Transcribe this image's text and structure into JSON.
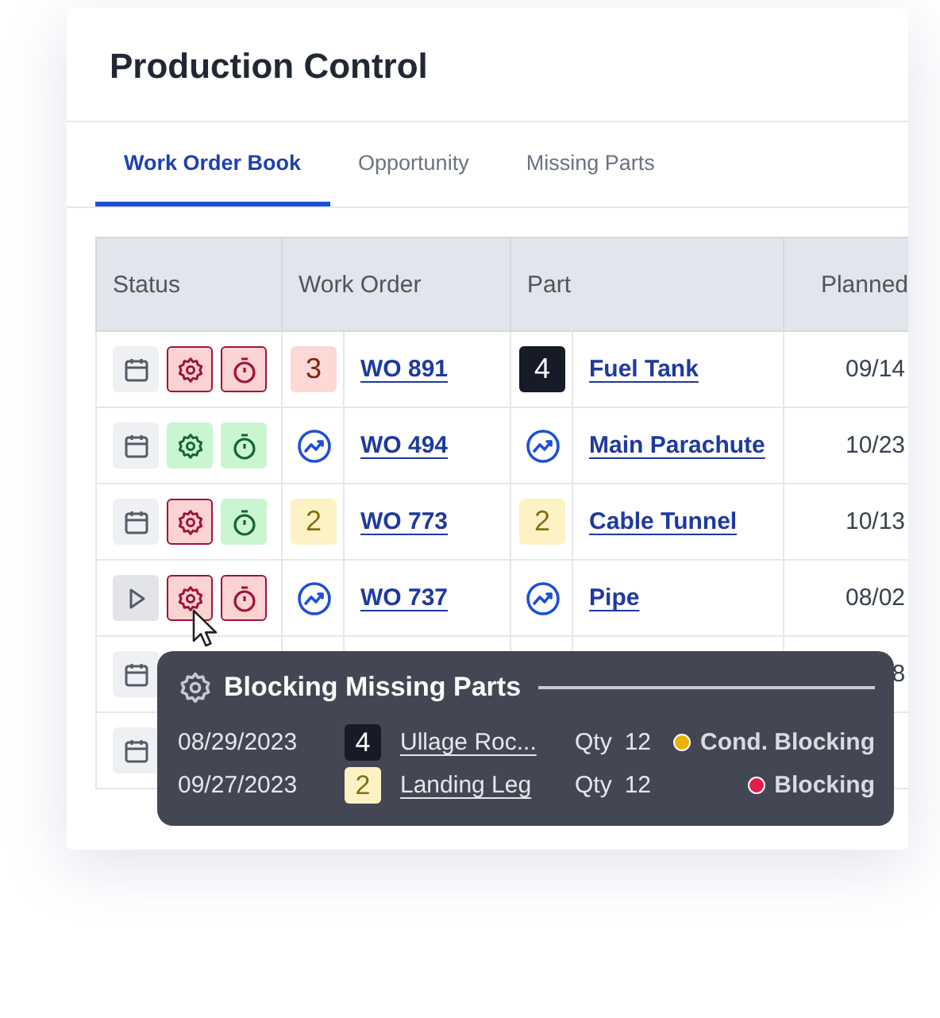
{
  "title": "Production Control",
  "tabs": [
    {
      "label": "Work Order Book",
      "selected": true
    },
    {
      "label": "Opportunity",
      "selected": false
    },
    {
      "label": "Missing Parts",
      "selected": false
    }
  ],
  "table": {
    "columns": [
      "Status",
      "Work Order",
      "Part",
      "Planned"
    ],
    "rows": [
      {
        "status": {
          "play": false,
          "gear_blocked": true,
          "timer_blocked": true
        },
        "wo_badge": {
          "kind": "count",
          "value": "3",
          "color": "#fcd9d4"
        },
        "work_order": "WO 891",
        "part_badge": {
          "kind": "count",
          "value": "4",
          "color": "#161b27"
        },
        "part": "Fuel Tank",
        "planned": "09/14"
      },
      {
        "status": {
          "play": false,
          "gear_blocked": false,
          "timer_blocked": false
        },
        "wo_badge": {
          "kind": "trend"
        },
        "work_order": "WO 494",
        "part_badge": {
          "kind": "trend"
        },
        "part": "Main Parachute",
        "planned": "10/23"
      },
      {
        "status": {
          "play": false,
          "gear_blocked": true,
          "timer_blocked": false
        },
        "wo_badge": {
          "kind": "count",
          "value": "2",
          "color": "#fdf2c4"
        },
        "work_order": "WO 773",
        "part_badge": {
          "kind": "count",
          "value": "2",
          "color": "#fdf2c4"
        },
        "part": "Cable Tunnel",
        "planned": "10/13"
      },
      {
        "status": {
          "play": true,
          "gear_blocked": true,
          "timer_blocked": true
        },
        "wo_badge": {
          "kind": "trend"
        },
        "work_order": "WO 737",
        "part_badge": {
          "kind": "trend"
        },
        "part": "Pipe",
        "planned": "08/02"
      },
      {
        "status": {
          "play": false
        },
        "planned": "8"
      },
      {
        "status": {
          "play": false
        }
      }
    ]
  },
  "tooltip": {
    "title": "Blocking Missing Parts",
    "rows": [
      {
        "date": "08/29/2023",
        "badge": {
          "value": "4",
          "color": "#161b27"
        },
        "part": "Ullage Roc...",
        "qty_label": "Qty",
        "qty": "12",
        "status": "Cond. Blocking",
        "color": "#eab308"
      },
      {
        "date": "09/27/2023",
        "badge": {
          "value": "2",
          "color": "#fdf2c4"
        },
        "part": "Landing Leg",
        "qty_label": "Qty",
        "qty": "12",
        "status": "Blocking",
        "color": "#e11d48"
      }
    ]
  }
}
